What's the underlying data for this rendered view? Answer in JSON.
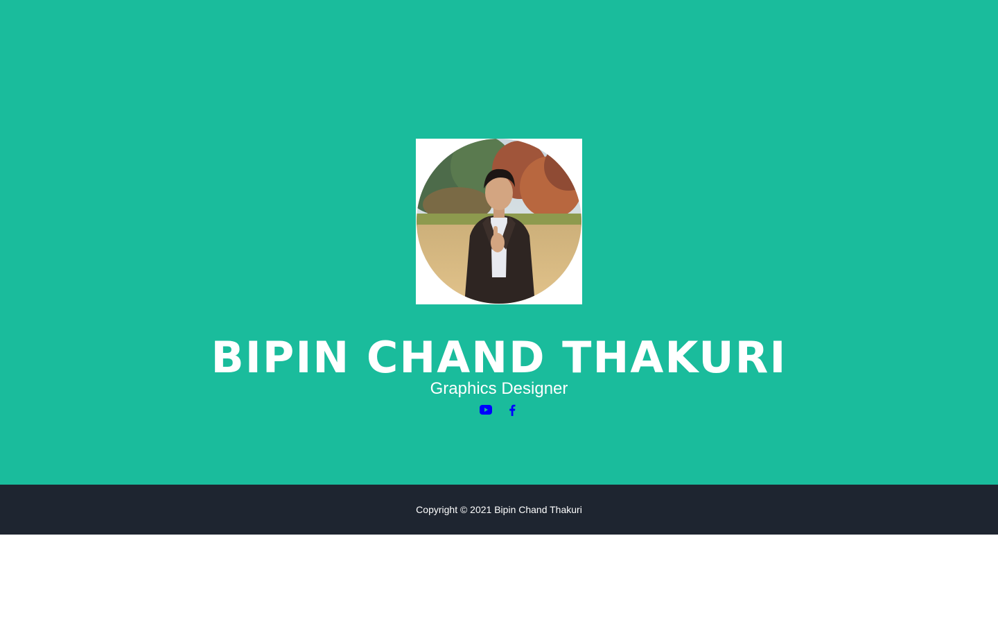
{
  "profile": {
    "name": "BIPIN CHAND THAKURI",
    "title": "Graphics Designer",
    "avatar_alt": "Profile photo of Bipin Chand Thakuri"
  },
  "social": [
    {
      "name": "YouTube",
      "icon": "youtube-icon"
    },
    {
      "name": "Facebook",
      "icon": "facebook-icon"
    }
  ],
  "footer": {
    "copyright": "Copyright © 2021 Bipin Chand Thakuri"
  },
  "colors": {
    "hero_bg": "#1abc9c",
    "footer_bg": "#1e2530",
    "social_icon": "#0000ff",
    "text": "#ffffff"
  }
}
